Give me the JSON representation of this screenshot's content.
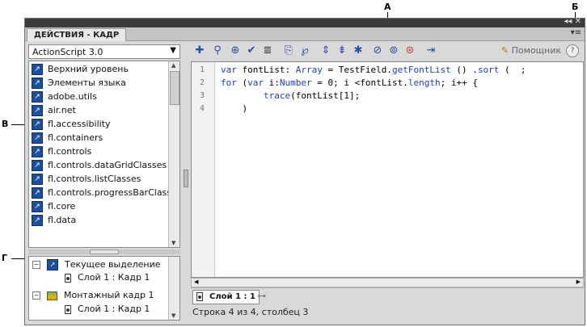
{
  "callouts": {
    "a": "А",
    "b": "Б",
    "v": "В",
    "g": "Г"
  },
  "panel": {
    "tab_title": "ДЕЙСТВИЯ - КАДР",
    "controls": "◂◂ ✕",
    "menu_icon": "▾≡"
  },
  "left": {
    "dropdown_value": "ActionScript 3.0",
    "library_items": [
      "Верхний уровень",
      "Элементы языка",
      "adobe.utils",
      "air.net",
      "fl.accessibility",
      "fl.containers",
      "fl.controls",
      "fl.controls.dataGridClasses",
      "fl.controls.listClasses",
      "fl.controls.progressBarClasses",
      "fl.core",
      "fl.data"
    ],
    "tree": {
      "current_selection": "Текущее выделение",
      "current_layer": "Слой 1 : Кадр 1",
      "scene_frame": "Монтажный кадр 1",
      "scene_layer": "Слой 1 : Кадр 1"
    }
  },
  "toolbar": {
    "icons": [
      "add-statement-icon",
      "find-icon",
      "target-icon",
      "check-syntax-icon",
      "auto-format-icon",
      "code-hint-icon",
      "debug-options-icon",
      "collapse-braces-icon",
      "collapse-selection-icon",
      "expand-all-icon",
      "apply-block-comment-icon",
      "apply-line-comment-icon",
      "remove-comment-icon",
      "show-hide-toolbox-icon"
    ],
    "helper_label": "Помощник",
    "help_label": "?"
  },
  "editor": {
    "line_numbers": [
      "1",
      "2",
      "3",
      "4"
    ]
  },
  "script_tab": "Слой 1 : 1",
  "status": "Строка 4 из 4, столбец 3",
  "colors": {
    "keyword": "#1b3cbf",
    "panel_bg": "#d9d9d9",
    "title_bar": "#3c3c3c"
  }
}
